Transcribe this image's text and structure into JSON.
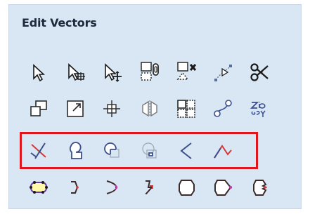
{
  "panel": {
    "title": "Edit Vectors",
    "highlight_color": "#e0161e"
  },
  "toolbar_rows": [
    [
      "select-icon",
      "node-edit-icon",
      "transform-icon",
      "group-icon",
      "ungroup-icon",
      "curve-fit-icon",
      "scissors-icon"
    ],
    [
      "align-icon",
      "size-icon",
      "center-icon",
      "mirror-icon",
      "array-icon",
      "nest-icon",
      "text-icon"
    ],
    [
      "trim-icon",
      "weld-icon",
      "subtract-icon",
      "intersect-icon",
      "fillet-icon",
      "extend-icon"
    ],
    [
      "offset-icon",
      "bracket-icon",
      "chevron-icon",
      "double-chevron-icon",
      "closed-shape-icon",
      "node-shape-icon",
      "open-shape-icon"
    ]
  ]
}
